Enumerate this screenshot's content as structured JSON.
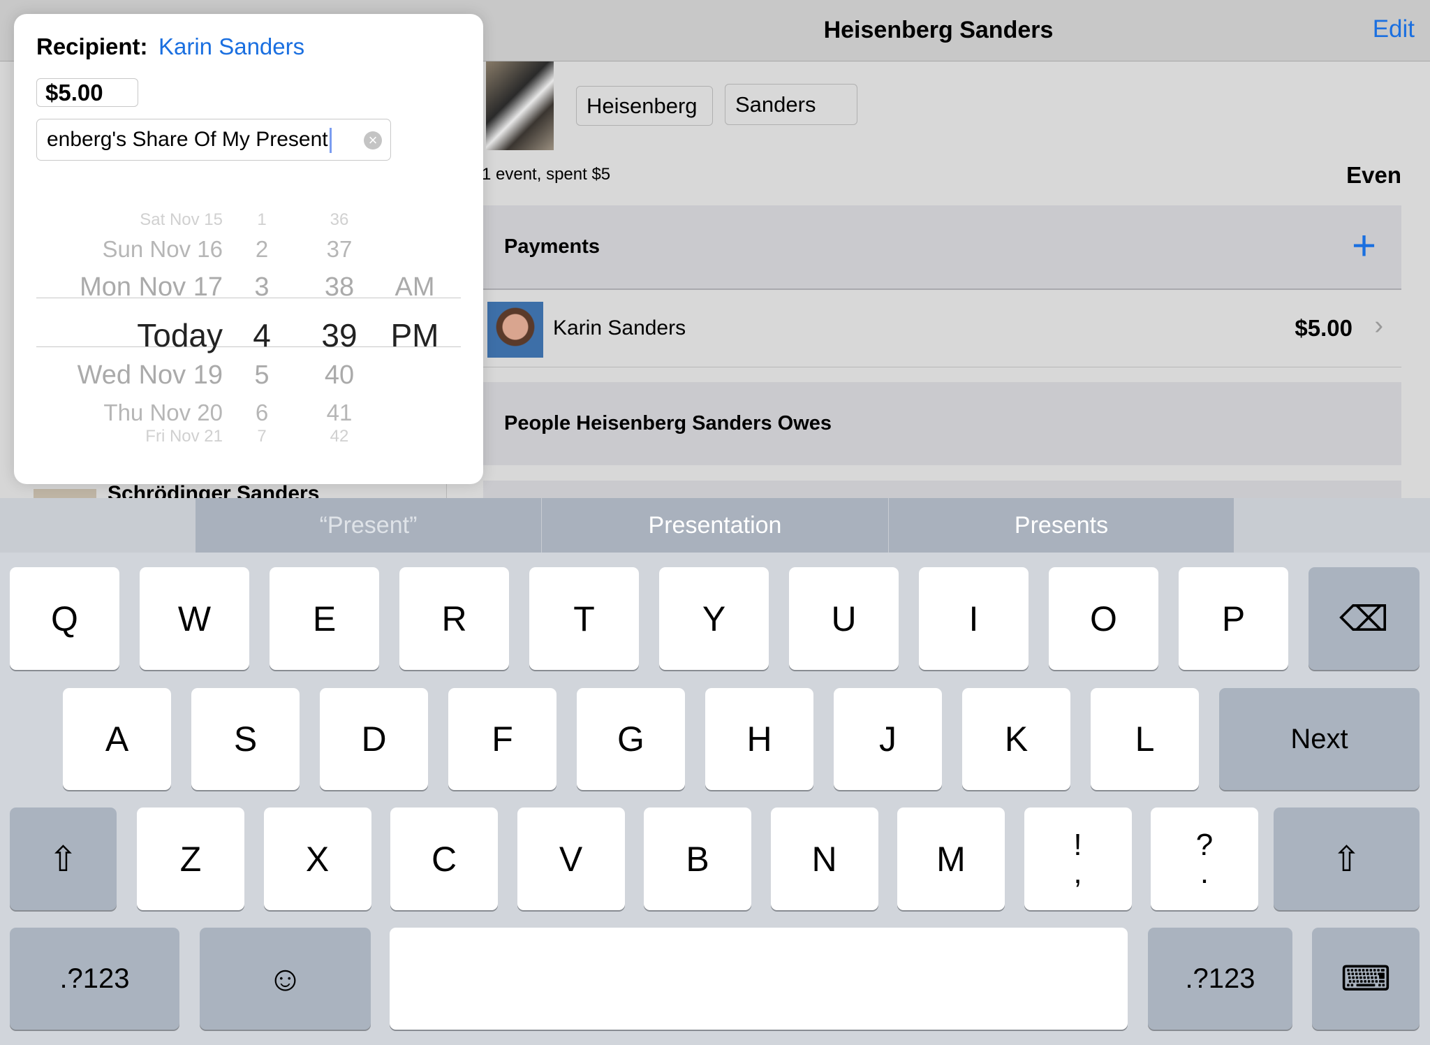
{
  "nav": {
    "title": "Heisenberg Sanders",
    "edit_label": "Edit"
  },
  "person": {
    "first_name": "Heisenberg",
    "last_name": "Sanders",
    "stats": "1 event, spent $5",
    "balance": "Even"
  },
  "payments": {
    "header": "Payments",
    "add_icon": "plus-icon",
    "rows": [
      {
        "name": "Karin Sanders",
        "amount": "$5.00"
      }
    ]
  },
  "owes": {
    "header": "People Heisenberg Sanders Owes"
  },
  "left_list": {
    "visible_item": "Schrödinger Sanders"
  },
  "popover": {
    "recipient_label": "Recipient:",
    "recipient_name": "Karin Sanders",
    "amount": "$5.00",
    "description": "enberg's Share Of My Present",
    "picker": {
      "dates": [
        "Sat Nov 15",
        "Sun Nov 16",
        "Mon Nov 17",
        "Today",
        "Wed Nov 19",
        "Thu Nov 20",
        "Fri Nov 21"
      ],
      "hours": [
        "1",
        "2",
        "3",
        "4",
        "5",
        "6",
        "7"
      ],
      "minutes": [
        "36",
        "37",
        "38",
        "39",
        "40",
        "41",
        "42"
      ],
      "ampm": [
        "AM",
        "PM"
      ],
      "selected": {
        "date": "Today",
        "hour": "4",
        "minute": "39",
        "ampm": "PM"
      }
    }
  },
  "keyboard": {
    "suggestions": [
      "“Present”",
      "Presentation",
      "Presents"
    ],
    "row1": [
      "Q",
      "W",
      "E",
      "R",
      "T",
      "Y",
      "U",
      "I",
      "O",
      "P"
    ],
    "row2": [
      "A",
      "S",
      "D",
      "F",
      "G",
      "H",
      "J",
      "K",
      "L"
    ],
    "next_label": "Next",
    "row3": [
      "Z",
      "X",
      "C",
      "V",
      "B",
      "N",
      "M",
      "!\n,",
      "?\n."
    ],
    "numbers_label": ".?123",
    "emoji_glyph": "☺",
    "shift_glyph": "⇧",
    "delete_glyph": "⌫",
    "hide_glyph": "⌨"
  }
}
